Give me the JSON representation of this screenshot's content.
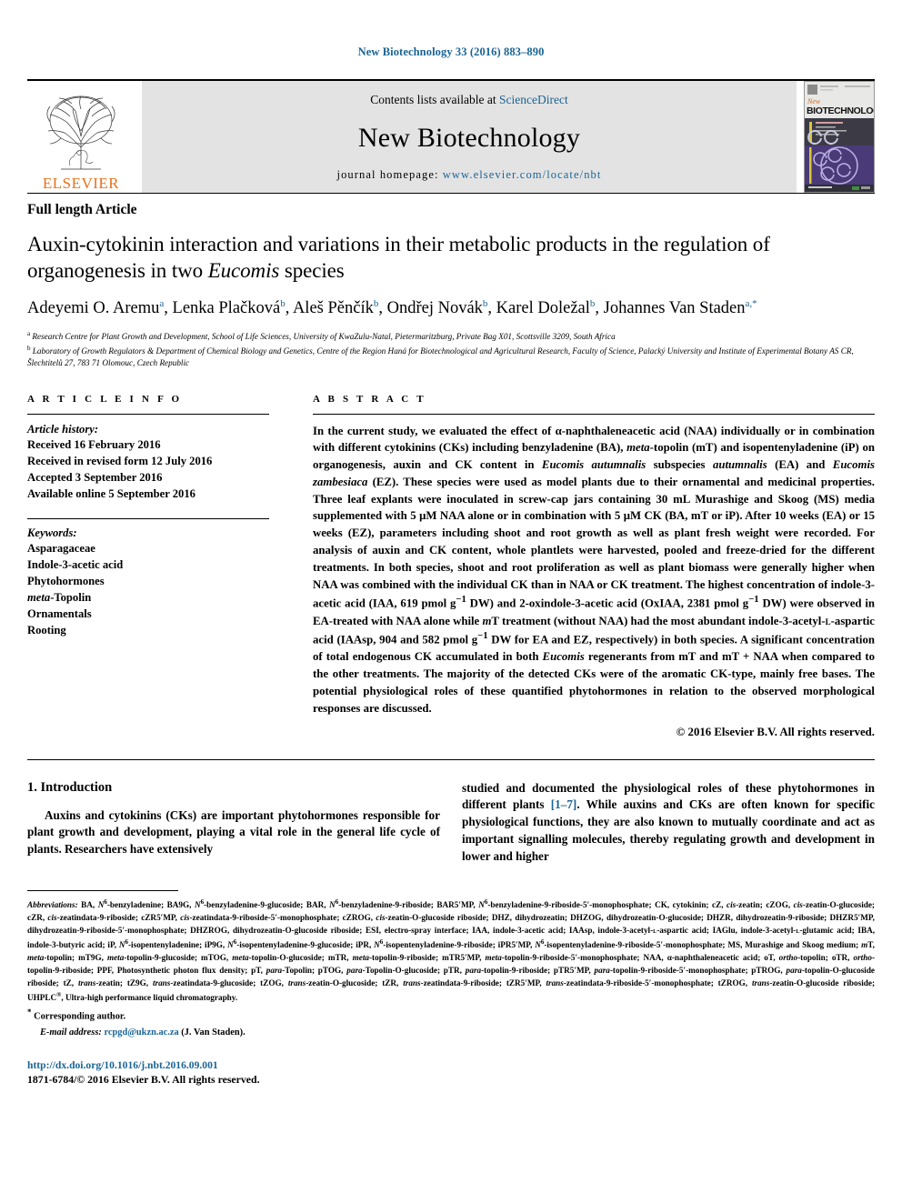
{
  "running_head": "New Biotechnology 33 (2016) 883–890",
  "masthead": {
    "contents_prefix": "Contents lists available at ",
    "sciencedirect": "ScienceDirect",
    "journal_name": "New Biotechnology",
    "homepage_prefix": "journal homepage: ",
    "homepage_url": "www.elsevier.com/locate/nbt",
    "publisher_logo_text": "ELSEVIER",
    "cover_title_small": "New",
    "cover_title": "BIOTECHNOLOGY",
    "accent_blue": "#1a6496",
    "elsevier_orange": "#E9711C"
  },
  "article": {
    "type": "Full length Article",
    "title_part1": "Auxin-cytokinin interaction and variations in their metabolic products in the regulation of organogenesis in two ",
    "title_italic": "Eucomis",
    "title_part2": " species",
    "authors_line1": "Adeyemi O. Aremu",
    "authors": "Adeyemi O. Aremu<sup>a</sup>, Lenka Plačková<sup>b</sup>, Aleš Pěnčík<sup>b</sup>, Ondřej Novák<sup>b</sup>, Karel Doležal<sup>b</sup>, Johannes Van Staden<sup>a,*</sup>",
    "affiliation_a": "Research Centre for Plant Growth and Development, School of Life Sciences, University of KwaZulu-Natal, Pietermaritzburg, Private Bag X01, Scottsville 3209, South Africa",
    "affiliation_b": "Laboratory of Growth Regulators & Department of Chemical Biology and Genetics, Centre of the Region Haná for Biotechnological and Agricultural Research, Faculty of Science, Palacký University and Institute of Experimental Botany AS CR, Šlechtitelů 27, 783 71 Olomouc, Czech Republic"
  },
  "article_info": {
    "heading": "A R T I C L E  I N F O",
    "history_title": "Article history:",
    "history": [
      "Received 16 February 2016",
      "Received in revised form 12 July 2016",
      "Accepted 3 September 2016",
      "Available online 5 September 2016"
    ],
    "keywords_title": "Keywords:",
    "keywords": [
      "Asparagaceae",
      "Indole-3-acetic acid",
      "Phytohormones",
      "meta-Topolin",
      "Ornamentals",
      "Rooting"
    ]
  },
  "abstract": {
    "heading": "A B S T R A C T",
    "text": "In the current study, we evaluated the effect of α-naphthaleneacetic acid (NAA) individually or in combination with different cytokinins (CKs) including benzyladenine (BA), <i>meta</i>-topolin (mT) and isopentenyladenine (iP) on organogenesis, auxin and CK content in <i>Eucomis autumnalis</i> subspecies <i>autumnalis</i> (EA) and <i>Eucomis zambesiaca</i> (EZ). These species were used as model plants due to their ornamental and medicinal properties. Three leaf explants were inoculated in screw-cap jars containing 30 mL Murashige and Skoog (MS) media supplemented with 5 μM NAA alone or in combination with 5 μM CK (BA, mT or iP). After 10 weeks (EA) or 15 weeks (EZ), parameters including shoot and root growth as well as plant fresh weight were recorded. For analysis of auxin and CK content, whole plantlets were harvested, pooled and freeze-dried for the different treatments. In both species, shoot and root proliferation as well as plant biomass were generally higher when NAA was combined with the individual CK than in NAA or CK treatment. The highest concentration of indole-3-acetic acid (IAA, 619 pmol g<sup>−1</sup> DW) and 2-oxindole-3-acetic acid (OxIAA, 2381 pmol g<sup>−1</sup> DW) were observed in EA-treated with NAA alone while <i>m</i>T treatment (without NAA) had the most abundant indole-3-acetyl-<span style=\"font-variant:small-caps\">l</span>-aspartic acid (IAAsp, 904 and 582 pmol g<sup>−1</sup> DW for EA and EZ, respectively) in both species. A significant concentration of total endogenous CK accumulated in both <i>Eucomis</i> regenerants from mT and mT + NAA when compared to the other treatments. The majority of the detected CKs were of the aromatic CK-type, mainly free bases. The potential physiological roles of these quantified phytohormones in relation to the observed morphological responses are discussed.",
    "copyright": "© 2016 Elsevier B.V. All rights reserved."
  },
  "introduction": {
    "heading": "1. Introduction",
    "left_paragraph": "Auxins and cytokinins (CKs) are important phytohormones responsible for plant growth and development, playing a vital role in the general life cycle of plants. Researchers have extensively",
    "right_paragraph_pre": "studied and documented the physiological roles of these phytohormones in different plants ",
    "right_reference": "[1–7]",
    "right_paragraph_post": ". While auxins and CKs are often known for specific physiological functions, they are also known to mutually coordinate and act as important signalling molecules, thereby regulating growth and development in lower and higher"
  },
  "footnotes": {
    "abbreviations_label": "Abbreviations:",
    "abbreviations_text": " BA, <i>N</i><sup>6</sup>-benzyladenine; BA9G, <i>N</i><sup>6</sup>-benzyladenine-9-glucoside; BAR, <i>N</i><sup>6</sup>-benzyladenine-9-riboside; BAR5′MP, <i>N</i><sup>6</sup>-benzyladenine-9-riboside-5′-monophosphate; CK, cytokinin; cZ, <i>cis</i>-zeatin; cZOG, <i>cis</i>-zeatin-O-glucoside; cZR, <i>cis</i>-zeatindata-9-riboside; cZR5′MP, <i>cis</i>-zeatindata-9-riboside-5′-monophosphate; cZROG, <i>cis</i>-zeatin-O-glucoside riboside; DHZ, dihydrozeatin; DHZOG, dihydrozeatin-O-glucoside; DHZR, dihydrozeatin-9-riboside; DHZR5′MP, dihydrozeatin-9-riboside-5′-monophosphate; DHZROG, dihydrozeatin-O-glucoside riboside; ESI, electro-spray interface; IAA, indole-3-acetic acid; IAAsp, indole-3-acetyl-<span style=\"font-variant:small-caps\">l</span>-aspartic acid; IAGlu, indole-3-acetyl-<span style=\"font-variant:small-caps\">l</span>-glutamic acid; IBA, indole-3-butyric acid; iP, <i>N</i><sup>6</sup>-isopentenyladenine; iP9G, <i>N</i><sup>6</sup>-isopentenyladenine-9-glucoside; iPR, <i>N</i><sup>6</sup>-isopentenyladenine-9-riboside; iPR5′MP, <i>N</i><sup>6</sup>-isopentenyladenine-9-riboside-5′-monophosphate; MS, Murashige and Skoog medium; <i>m</i>T, <i>meta</i>-topolin; mT9G, <i>meta</i>-topolin-9-glucoside; mTOG, <i>meta</i>-topolin-O-glucoside; mTR, <i>meta</i>-topolin-9-riboside; mTR5′MP, <i>meta</i>-topolin-9-riboside-5′-monophosphate; NAA, α-naphthaleneacetic acid; oT, <i>ortho</i>-topolin; oTR, <i>ortho</i>-topolin-9-riboside; PPF, Photosynthetic photon flux density; pT, <i>para</i>-Topolin; pTOG, <i>para</i>-Topolin-O-glucoside; pTR, <i>para</i>-topolin-9-riboside; pTR5′MP, <i>para</i>-topolin-9-riboside-5′-monophosphate; pTROG, <i>para</i>-topolin-O-glucoside riboside; tZ, <i>trans</i>-zeatin; tZ9G, <i>trans</i>-zeatindata-9-glucoside; tZOG, <i>trans</i>-zeatin-O-glucoside; tZR, <i>trans</i>-zeatindata-9-riboside; tZR5′MP, <i>trans</i>-zeatindata-9-riboside-5′-monophosphate; tZROG, <i>trans</i>-zeatin-O-glucoside riboside; UHPLC<sup>®</sup>, Ultra-high performance liquid chromatography.",
    "corresponding_author": "Corresponding author.",
    "email_label": "E-mail address:",
    "email": "rcpgd@ukzn.ac.za",
    "email_attribution": "(J. Van Staden).",
    "doi": "http://dx.doi.org/10.1016/j.nbt.2016.09.001",
    "issn_copyright": "1871-6784/© 2016 Elsevier B.V. All rights reserved."
  }
}
